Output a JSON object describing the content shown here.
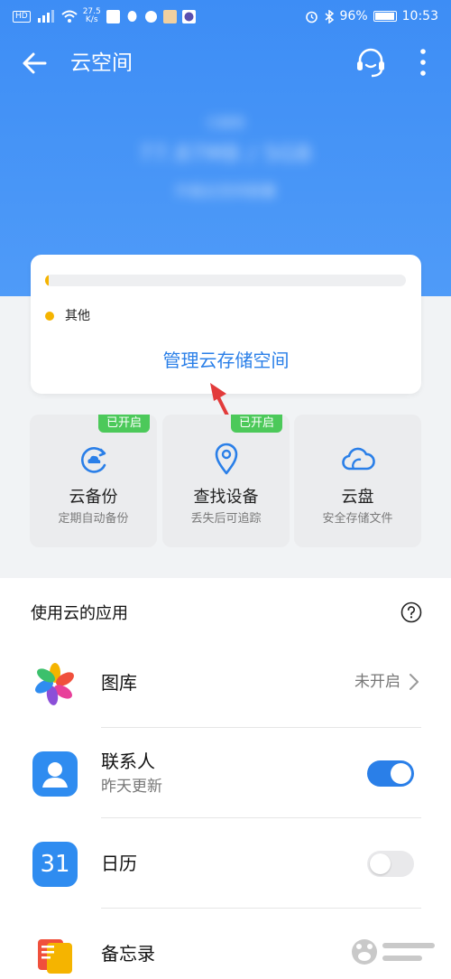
{
  "colors": {
    "header_blue": "#4a96f7",
    "accent_blue": "#2a7fe8",
    "badge_green": "#4cc95a",
    "legend_yellow": "#f5b400",
    "toggle_on": "#2a7fe8",
    "toggle_off": "#e9e9eb"
  },
  "status_bar": {
    "speed_value": "27.5",
    "speed_unit": "K/s",
    "battery": "96%",
    "time": "10:53"
  },
  "header": {
    "title": "云空间",
    "used_label": "已使用",
    "used_value": "77.87MB / 5GB",
    "upgrade_text": "升级云空间容量"
  },
  "storage": {
    "used_fraction": 0.01,
    "legend_label": "其他",
    "manage_label": "管理云存储空间"
  },
  "services": [
    {
      "name": "云备份",
      "desc": "定期自动备份",
      "badge": "已开启",
      "icon": "cloud-backup-icon"
    },
    {
      "name": "查找设备",
      "desc": "丢失后可追踪",
      "badge": "已开启",
      "icon": "location-pin-icon"
    },
    {
      "name": "云盘",
      "desc": "安全存储文件",
      "badge": "",
      "icon": "cloud-drive-icon"
    }
  ],
  "apps_section": {
    "title": "使用云的应用",
    "items": [
      {
        "name": "图库",
        "subtitle": "",
        "status": "未开启",
        "control": "chevron"
      },
      {
        "name": "联系人",
        "subtitle": "昨天更新",
        "status": "",
        "control": "toggle",
        "toggle_on": true
      },
      {
        "name": "日历",
        "subtitle": "",
        "status": "",
        "control": "toggle",
        "toggle_on": false,
        "icon_text": "31"
      },
      {
        "name": "备忘录",
        "subtitle": "",
        "status": "",
        "control": "none"
      }
    ]
  }
}
